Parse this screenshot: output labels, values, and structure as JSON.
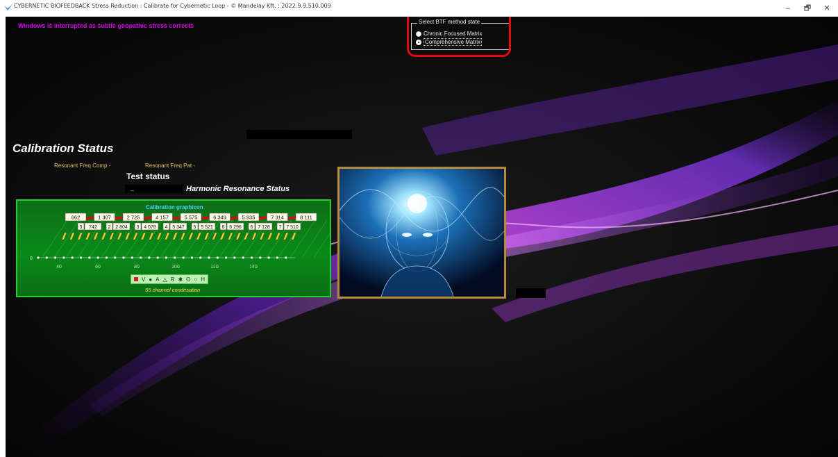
{
  "window": {
    "title": "CYBERNETIC BIOFEEDBACK Stress Reduction : Calibrate for Cybernetic Loop - © Mandelay Kft. : 2022.9.9.510.009",
    "minimize_glyph": "–",
    "maximize_glyph": "🗗",
    "close_glyph": "✕"
  },
  "warning_text": "Windows is interrupted as subtle geopathic stress corrects",
  "btf": {
    "legend": "Select BTF method state",
    "options": [
      "Chronic Focused Matrix",
      "Comprehensive Matrix"
    ],
    "selected": "Comprehensive Matrix"
  },
  "calibration": {
    "title": "Calibration Status",
    "resonant_freq_comp": "Resonant Freq Comp  -",
    "resonant_freq_pat": "Resonant Freq Pat  -",
    "test_status": "Test status",
    "status_value": "_",
    "harmonic_status": "Harmonic Resonance Status"
  },
  "graph": {
    "title": "Calibration graphicon",
    "top_boxes": [
      "662",
      "1 307",
      "2 725",
      "4 157",
      "5 575",
      "6 349",
      "5 935",
      "7 314",
      "8 111"
    ],
    "second_boxes": [
      {
        "idx": "3",
        "val": "742"
      },
      {
        "idx": "2",
        "val": "2 804"
      },
      {
        "idx": "3",
        "val": "4 078"
      },
      {
        "idx": "4",
        "val": "5 347"
      },
      {
        "idx": "5",
        "val": "5 521"
      },
      {
        "idx": "6",
        "val": "6 296"
      },
      {
        "idx": "6",
        "val": "7 128"
      },
      {
        "idx": "7",
        "val": "7 510"
      }
    ],
    "axis_zero": "0",
    "axis_ticks": [
      "40",
      "60",
      "80",
      "100",
      "120",
      "140"
    ],
    "legend_items": [
      "V",
      "A",
      "R",
      "O",
      "H"
    ],
    "legend_symbols": [
      "●",
      "△",
      "✱",
      "○"
    ],
    "condensation": "55 channel condesation",
    "colors": {
      "panel": "#0a8a1a",
      "border": "#1ed22f",
      "highlight": "#e8080c"
    }
  }
}
